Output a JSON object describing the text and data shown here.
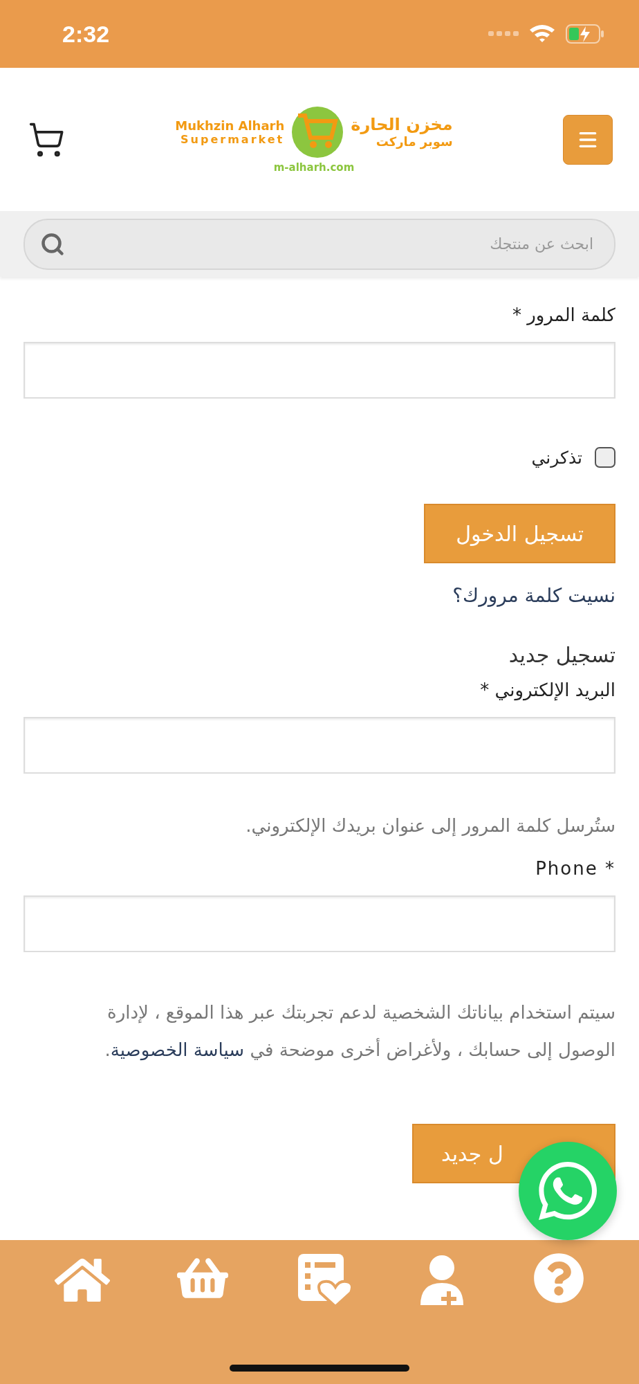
{
  "status_bar": {
    "time": "2:32"
  },
  "header": {
    "logo": {
      "latin_name": "Mukhzin Alharh",
      "latin_sub": "Supermarket",
      "arabic_name": "مخزن الحارة",
      "arabic_sub": "سوبر ماركت",
      "domain": "m-alharh.com"
    }
  },
  "search": {
    "placeholder": "ابحث عن منتجك"
  },
  "login": {
    "password_label": "كلمة المرور *",
    "remember": {
      "label": "تذكرني",
      "checked": false
    },
    "submit": "تسجيل الدخول",
    "forgot": "نسيت كلمة مرورك؟"
  },
  "register": {
    "heading": "تسجيل جديد",
    "email_label": "البريد الإلكتروني *",
    "note": "ستُرسل كلمة المرور إلى عنوان بريدك الإلكتروني.",
    "phone_label": "Phone *",
    "privacy": {
      "text": "سيتم استخدام بياناتك الشخصية لدعم تجربتك عبر هذا الموقع ، لإدارة الوصول إلى حسابك ، ولأغراض أخرى موضحة في",
      "link": "سياسة الخصوصية",
      "suffix": "."
    },
    "submit": "ل جديد"
  }
}
